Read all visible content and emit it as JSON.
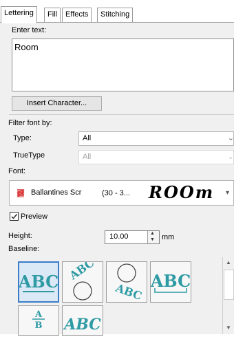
{
  "tabs": [
    {
      "label": "Lettering",
      "active": true
    },
    {
      "label": "Fill",
      "active": false
    },
    {
      "label": "Effects",
      "active": false
    },
    {
      "label": "Stitching",
      "active": false
    }
  ],
  "enter_text": {
    "label": "Enter text:",
    "value": "Room"
  },
  "insert_character_label": "Insert Character...",
  "filter": {
    "label": "Filter font by:",
    "type_label": "Type:",
    "type_value": "All",
    "truetype_label": "TrueType",
    "truetype_value": "All"
  },
  "font": {
    "label": "Font:",
    "name": "Ballantines Scr",
    "size_range": "(30 - 3...",
    "preview_text": "ROOm",
    "icon": "font-zigzag-icon"
  },
  "preview": {
    "label": "Preview",
    "checked": true
  },
  "height": {
    "label": "Height:",
    "value": "10.00",
    "unit": "mm"
  },
  "baseline": {
    "label": "Baseline:",
    "selected_index": 0,
    "options": [
      {
        "glyph": "ABC",
        "icon": "baseline-straight-icon"
      },
      {
        "glyph": "ABC",
        "icon": "baseline-arc-top-icon"
      },
      {
        "glyph": "ABC",
        "icon": "baseline-arc-bottom-icon"
      },
      {
        "glyph": "ABC",
        "icon": "baseline-bracket-icon"
      },
      {
        "glyph": "ABC",
        "icon": "baseline-vertical-icon"
      },
      {
        "glyph": "ABC",
        "icon": "baseline-wave-icon"
      }
    ]
  },
  "colors": {
    "accent": "#2e9aa4",
    "selection": "#3a7cc8",
    "font_icon": "#d93a3a"
  }
}
